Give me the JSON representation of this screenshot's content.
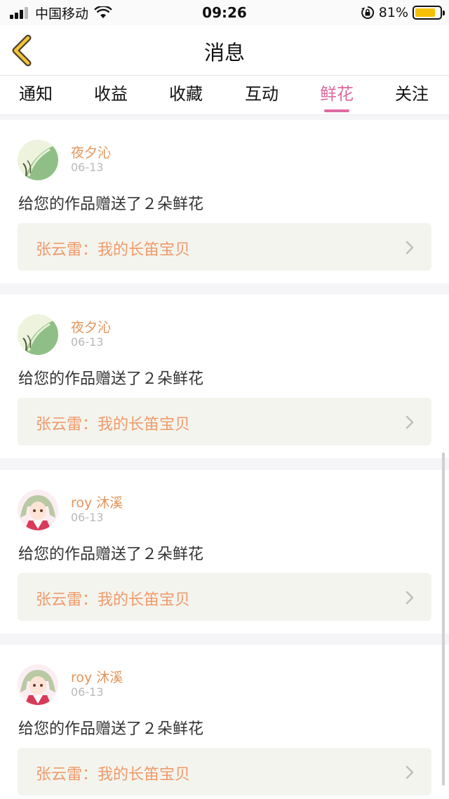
{
  "status_bar": {
    "carrier": "中国移动",
    "time": "09:26",
    "battery_percent": "81%",
    "battery_level": 0.81,
    "battery_color": "#f6c100"
  },
  "header": {
    "title": "消息",
    "back_icon": "chevron-left-icon"
  },
  "tabs": [
    {
      "label": "通知",
      "active": false
    },
    {
      "label": "收益",
      "active": false
    },
    {
      "label": "收藏",
      "active": false
    },
    {
      "label": "互动",
      "active": false
    },
    {
      "label": "鲜花",
      "active": true
    },
    {
      "label": "关注",
      "active": false
    }
  ],
  "colors": {
    "accent": "#e06aa1",
    "username": "#e2955b",
    "work_title": "#ee9a6a"
  },
  "messages": [
    {
      "username": "夜夕沁",
      "date": "06-13",
      "text": "给您的作品赠送了２朵鲜花",
      "work": "张云雷：我的长笛宝贝",
      "avatar": "leaf"
    },
    {
      "username": "夜夕沁",
      "date": "06-13",
      "text": "给您的作品赠送了２朵鲜花",
      "work": "张云雷：我的长笛宝贝",
      "avatar": "leaf"
    },
    {
      "username": "roy 沐溪",
      "date": "06-13",
      "text": "给您的作品赠送了２朵鲜花",
      "work": "张云雷：我的长笛宝贝",
      "avatar": "anime"
    },
    {
      "username": "roy 沐溪",
      "date": "06-13",
      "text": "给您的作品赠送了２朵鲜花",
      "work": "张云雷：我的长笛宝贝",
      "avatar": "anime"
    }
  ]
}
